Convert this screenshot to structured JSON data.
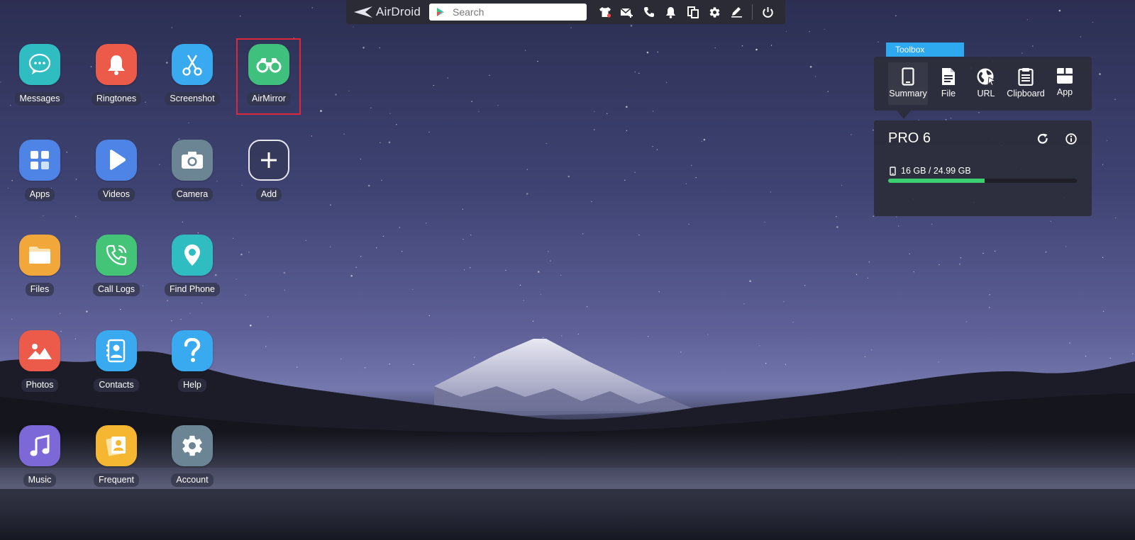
{
  "topbar": {
    "logo_text": "AirDroid",
    "search_placeholder": "Search",
    "icons": [
      "shirt-icon",
      "mail-add-icon",
      "phone-icon",
      "bell-icon",
      "copy-icon",
      "gear-icon",
      "pen-icon",
      "power-icon"
    ]
  },
  "apps": [
    {
      "id": "messages",
      "label": "Messages",
      "icon": "chat-bubble-icon",
      "color": "#2fbdc2"
    },
    {
      "id": "ringtones",
      "label": "Ringtones",
      "icon": "bell-icon",
      "color": "#ec5a4a"
    },
    {
      "id": "screenshot",
      "label": "Screenshot",
      "icon": "scissors-icon",
      "color": "#39a9f0"
    },
    {
      "id": "airmirror",
      "label": "AirMirror",
      "icon": "binoculars-icon",
      "color": "#3fc17d"
    },
    {
      "id": "apps",
      "label": "Apps",
      "icon": "grid-icon",
      "color": "#4e84e6"
    },
    {
      "id": "videos",
      "label": "Videos",
      "icon": "play-icon",
      "color": "#4e84e6"
    },
    {
      "id": "camera",
      "label": "Camera",
      "icon": "camera-icon",
      "color": "#6c8595"
    },
    {
      "id": "add",
      "label": "Add",
      "icon": "plus-icon",
      "color": "transparent"
    },
    {
      "id": "files",
      "label": "Files",
      "icon": "folder-icon",
      "color": "#f2a73a"
    },
    {
      "id": "call-logs",
      "label": "Call Logs",
      "icon": "phone-icon",
      "color": "#43c476"
    },
    {
      "id": "find-phone",
      "label": "Find Phone",
      "icon": "location-pin-icon",
      "color": "#2fbdc2"
    },
    {
      "id": "photos",
      "label": "Photos",
      "icon": "landscape-icon",
      "color": "#ec5a4a"
    },
    {
      "id": "contacts",
      "label": "Contacts",
      "icon": "contact-card-icon",
      "color": "#39a9f0"
    },
    {
      "id": "help",
      "label": "Help",
      "icon": "question-icon",
      "color": "#39a9f0"
    },
    {
      "id": "music",
      "label": "Music",
      "icon": "music-note-icon",
      "color": "#7d68d8"
    },
    {
      "id": "frequent",
      "label": "Frequent",
      "icon": "contact-stack-icon",
      "color": "#f5b731"
    },
    {
      "id": "account",
      "label": "Account",
      "icon": "gear-icon",
      "color": "#6c8595"
    }
  ],
  "toolbox": {
    "title": "Toolbox",
    "items": [
      {
        "label": "Summary",
        "icon": "phone-device-icon",
        "active": true
      },
      {
        "label": "File",
        "icon": "document-icon",
        "active": false
      },
      {
        "label": "URL",
        "icon": "globe-icon",
        "active": false
      },
      {
        "label": "Clipboard",
        "icon": "clipboard-icon",
        "active": false
      },
      {
        "label": "App",
        "icon": "app-box-icon",
        "active": false
      }
    ]
  },
  "device": {
    "name": "PRO 6",
    "storage_text": "16 GB / 24.99 GB",
    "storage_used_fraction": 0.51
  }
}
